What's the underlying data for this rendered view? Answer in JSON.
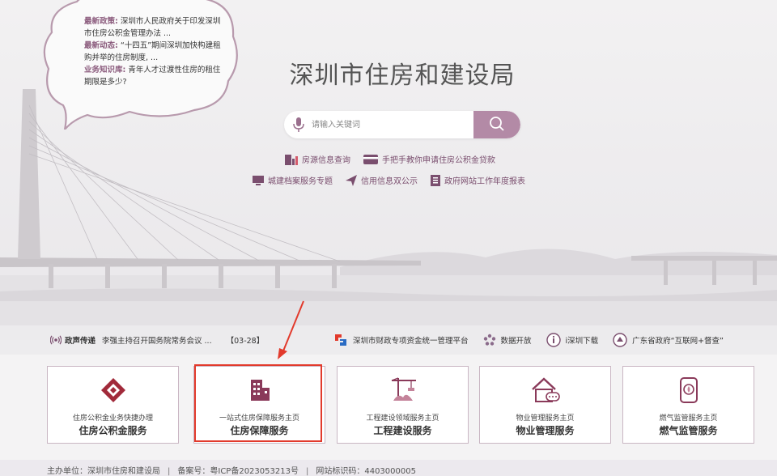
{
  "bubble": {
    "items": [
      {
        "label": "最新政策:",
        "text": "深圳市人民政府关于印发深圳市住房公积金管理办法 ..."
      },
      {
        "label": "最新动态:",
        "text": "“十四五”期间深圳加快构建租购并举的住房制度, ..."
      },
      {
        "label": "业务知识库:",
        "text": "青年人才过渡性住房的租住期限是多少?"
      }
    ]
  },
  "header": {
    "title": "深圳市住房和建设局"
  },
  "search": {
    "placeholder": "请输入关键词"
  },
  "quick_links_row1": [
    "房源信息查询",
    "手把手教你申请住房公积金贷款"
  ],
  "quick_links_row2": [
    "城建档案服务专题",
    "信用信息双公示",
    "政府网站工作年度报表"
  ],
  "newsbar": {
    "label": "政声传递",
    "headline": "李强主持召开国务院常务会议 ...",
    "date": "【03-28】",
    "links": [
      "深圳市财政专项资金统一管理平台",
      "数据开放",
      "i深圳下载",
      "广东省政府“互联网+督查”"
    ]
  },
  "cards": [
    {
      "sub": "住房公积金业务快捷办理",
      "main": "住房公积金服务",
      "icon": "housing-fund-icon"
    },
    {
      "sub": "一站式住房保障服务主页",
      "main": "住房保障服务",
      "icon": "building-icon"
    },
    {
      "sub": "工程建设领域服务主页",
      "main": "工程建设服务",
      "icon": "crane-icon"
    },
    {
      "sub": "物业管理服务主页",
      "main": "物业管理服务",
      "icon": "house-chat-icon"
    },
    {
      "sub": "燃气监管服务主页",
      "main": "燃气监管服务",
      "icon": "gas-icon"
    }
  ],
  "footer": {
    "host": "主办单位：深圳市住房和建设局",
    "icp": "备案号：粤ICP备2023053213号",
    "code": "网站标识码：4403000005"
  },
  "colors": {
    "accent": "#b38aa6",
    "link": "#7a4e6e",
    "highlight": "#e23a2c"
  }
}
